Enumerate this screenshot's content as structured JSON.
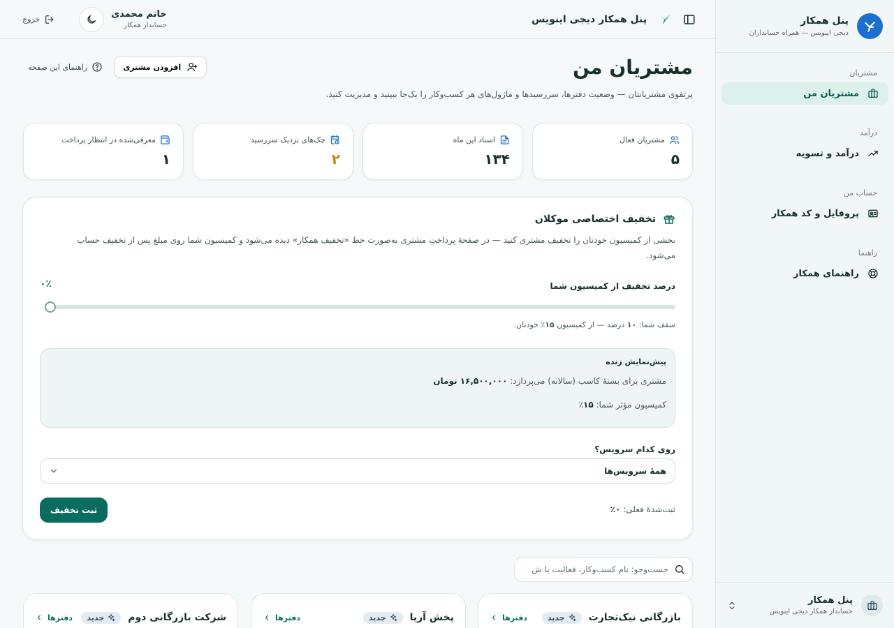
{
  "sidebar": {
    "brand_title": "پنل همکار",
    "brand_sub": "دیجی اینویس — همراه حسابداران",
    "groups": [
      {
        "label": "مشتریان",
        "items": [
          {
            "label": "مشتریان من",
            "icon": "briefcase-icon"
          }
        ]
      },
      {
        "label": "درآمد",
        "items": [
          {
            "label": "درآمد و تسویه",
            "icon": "trend-icon"
          }
        ]
      },
      {
        "label": "حساب من",
        "items": [
          {
            "label": "پروفایل و کد همکار",
            "icon": "id-card-icon"
          }
        ]
      },
      {
        "label": "راهنما",
        "items": [
          {
            "label": "راهنمای همکار",
            "icon": "lifebuoy-icon"
          }
        ]
      }
    ],
    "footer_title": "پنل همکار",
    "footer_sub": "حسابدار همکار دیجی اینویس"
  },
  "topbar": {
    "title": "پنل همکار دیجی اینویس",
    "user_name": "خانم محمدی",
    "user_role": "حسابدار همکار",
    "logout_label": "خروج"
  },
  "page": {
    "title": "مشتریان من",
    "description": "پرتفوی مشتریانتان — وضعیت دفترها، سررسیدها و ماژول‌های هر کسب‌وکار را یک‌جا ببینید و مدیریت کنید.",
    "add_customer_label": "افزودن مشتری",
    "help_label": "راهنمای این صفحه"
  },
  "stats": [
    {
      "label": "مشتریان فعال",
      "value": "۵",
      "icon": "users-icon",
      "color": "#17302d"
    },
    {
      "label": "اسناد این ماه",
      "value": "۱۳۴",
      "icon": "document-icon",
      "color": "#17302d"
    },
    {
      "label": "چک‌های نزدیک سررسید",
      "value": "۲",
      "icon": "calendar-clock-icon",
      "color": "#c98a0c"
    },
    {
      "label": "معرفی‌شده در انتظار پرداخت",
      "value": "۱",
      "icon": "wallet-icon",
      "color": "#17302d"
    }
  ],
  "discount": {
    "title": "تخفیف اختصاصی موکلان",
    "description": "بخشی از کمیسیون خودتان را تخفیف مشتری کنید — در صفحهٔ پرداختِ مشتری به‌صورت خط «تخفیف همکار» دیده می‌شود و کمیسیون شما روی مبلغ پس از تخفیف حساب می‌شود.",
    "slider_label": "درصد تخفیف از کمیسیون شما",
    "slider_value_text": "۰٪",
    "slider_fraction": 0,
    "note_prefix": "سقف شما: ",
    "note_cap": "۱۰",
    "note_mid": " درصد — از کمیسیون ",
    "note_comm": "۱۵",
    "note_suffix": "٪ خودتان.",
    "preview_title": "پیش‌نمایش زنده",
    "preview_line1_prefix": "مشتری برای بستهٔ کاسب (سالانه) می‌پردازد: ",
    "preview_line1_amount": "۱۶,۵۰۰,۰۰۰ تومان",
    "preview_line2_prefix": "کمیسیون مؤثر شما: ",
    "preview_line2_value": "۱۵",
    "preview_line2_suffix": "٪",
    "service_label": "روی کدام سرویس؟",
    "service_selected": "همهٔ سرویس‌ها",
    "saved_prefix": "ثبت‌شدهٔ فعلی: ",
    "saved_value": "۰٪",
    "submit_label": "ثبت تخفیف"
  },
  "search": {
    "placeholder": "جست‌وجو: نام کسب‌وکار، فعالیت یا ش"
  },
  "customers": [
    {
      "name": "بازرگانی نیک‌تجارت",
      "badge": "جدید",
      "link": "دفترها"
    },
    {
      "name": "پخش آریا",
      "badge": "جدید",
      "link": "دفترها"
    },
    {
      "name": "شرکت بازرگانی دوم",
      "badge": "جدید",
      "link": "دفترها"
    }
  ],
  "colors": {
    "accent": "#0a6b5f",
    "brand_blue": "#1a6fcf",
    "warning": "#c98a0c"
  }
}
